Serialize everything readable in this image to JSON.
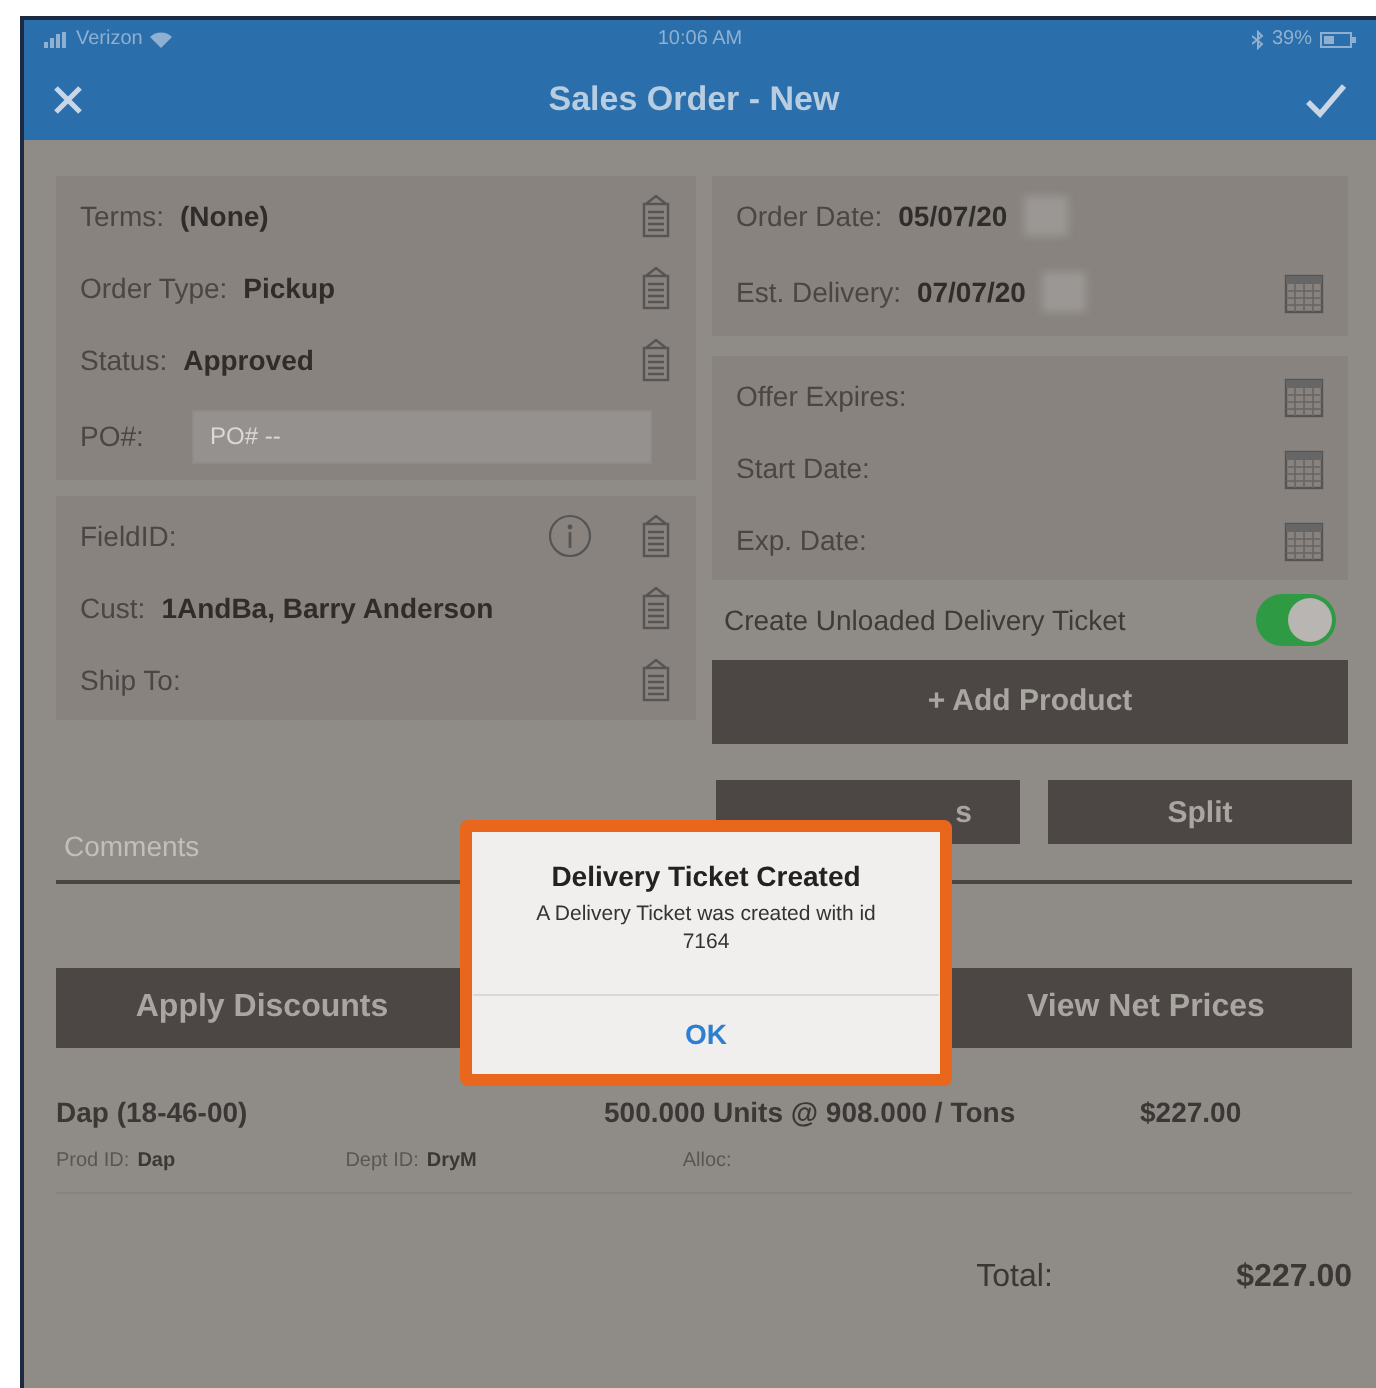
{
  "status_bar": {
    "carrier": "Verizon",
    "time": "10:06 AM",
    "battery": "39%"
  },
  "nav": {
    "title": "Sales Order - New"
  },
  "left_panels": [
    {
      "rows": [
        {
          "kind": "picker",
          "label": "Terms:",
          "value": "(None)"
        },
        {
          "kind": "picker",
          "label": "Order Type:",
          "value": "Pickup"
        },
        {
          "kind": "picker",
          "label": "Status:",
          "value": "Approved"
        },
        {
          "kind": "input",
          "label": "PO#:",
          "placeholder": "PO# --"
        }
      ]
    },
    {
      "rows": [
        {
          "kind": "info",
          "label": "FieldID:",
          "value": ""
        },
        {
          "kind": "picker",
          "label": "Cust:",
          "value": "1AndBa, Barry Anderson"
        },
        {
          "kind": "picker",
          "label": "Ship To:",
          "value": ""
        }
      ]
    }
  ],
  "right_panels": [
    {
      "rows": [
        {
          "kind": "date_plain",
          "label": "Order Date:",
          "value": "05/07/20"
        },
        {
          "kind": "date",
          "label": "Est. Delivery:",
          "value": "07/07/20"
        }
      ]
    },
    {
      "rows": [
        {
          "kind": "date",
          "label": "Offer Expires:",
          "value": ""
        },
        {
          "kind": "date",
          "label": "Start Date:",
          "value": ""
        },
        {
          "kind": "date",
          "label": "Exp. Date:",
          "value": ""
        }
      ]
    }
  ],
  "toggle": {
    "label": "Create Unloaded Delivery Ticket",
    "on": true
  },
  "add_product": "+ Add Product",
  "small_buttons": [
    "s",
    "Split"
  ],
  "comments": {
    "placeholder": "Comments"
  },
  "wide_buttons": [
    "Apply Discounts",
    "View Net Prices"
  ],
  "line_item": {
    "name": "Dap (18-46-00)",
    "quantity": "500.000 Units @  908.000 / Tons",
    "amount": "$227.00",
    "prod_label": "Prod ID:",
    "prod": "Dap",
    "dept_label": "Dept ID:",
    "dept": "DryM",
    "alloc_label": "Alloc:"
  },
  "total": {
    "label": "Total:",
    "value": "$227.00"
  },
  "alert": {
    "title": "Delivery Ticket Created",
    "message": "A Delivery Ticket was created with id 7164",
    "button": "OK"
  }
}
